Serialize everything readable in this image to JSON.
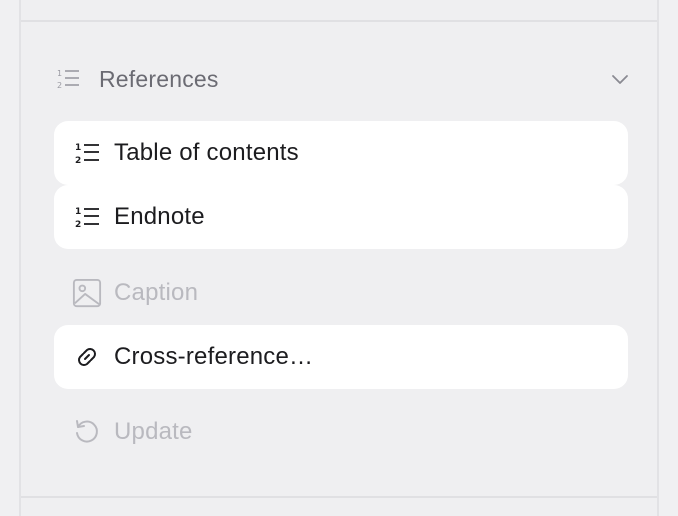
{
  "section": {
    "title": "References",
    "icon": "numbered-list-icon",
    "expand_icon": "chevron-down-icon"
  },
  "items": [
    {
      "label": "Table of contents",
      "icon": "numbered-list-icon",
      "enabled": true
    },
    {
      "label": "Endnote",
      "icon": "numbered-list-icon",
      "enabled": true
    },
    {
      "label": "Caption",
      "icon": "image-icon",
      "enabled": false
    },
    {
      "label": "Cross-reference…",
      "icon": "link-icon",
      "enabled": true
    },
    {
      "label": "Update",
      "icon": "refresh-icon",
      "enabled": false
    }
  ],
  "colors": {
    "panel_bg": "#efeff1",
    "card_bg": "#ffffff",
    "text": "#1c1c1f",
    "disabled_text": "#b9b9bf",
    "header_text": "#6b6b73"
  }
}
